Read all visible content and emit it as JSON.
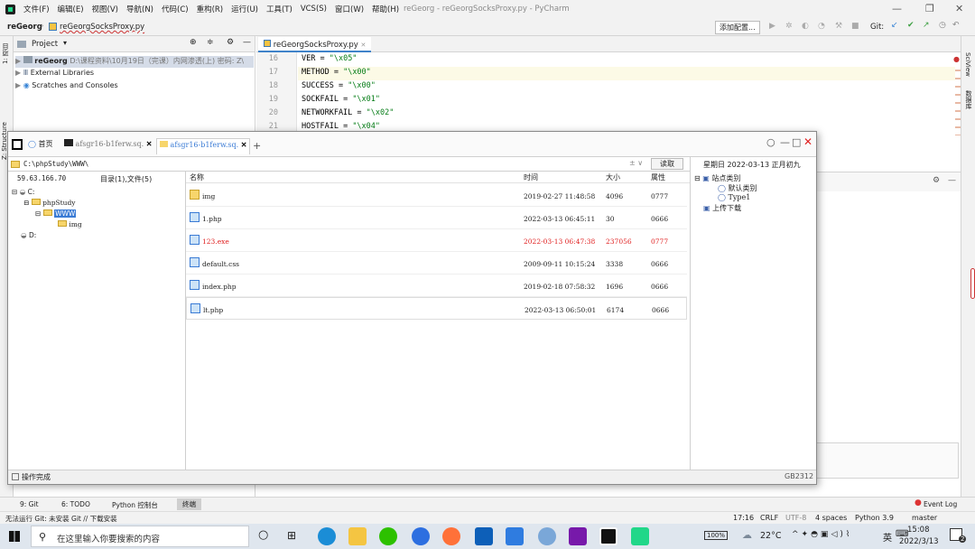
{
  "ide": {
    "menu": [
      "文件(F)",
      "编辑(E)",
      "视图(V)",
      "导航(N)",
      "代码(C)",
      "重构(R)",
      "运行(U)",
      "工具(T)",
      "VCS(S)",
      "窗口(W)",
      "帮助(H)"
    ],
    "window_title": "reGeorg - reGeorgSocksProxy.py - PyCharm",
    "breadcrumb": {
      "project": "reGeorg",
      "file": "reGeorgSocksProxy.py"
    },
    "add_config": "添加配置...",
    "git_label": "Git:",
    "project_panel": {
      "title": "Project",
      "items": [
        {
          "name": "reGeorg",
          "path": "D:\\课程资料\\10月19日（完课）内网渗透(上) 密码: Z\\"
        },
        {
          "name": "External Libraries"
        },
        {
          "name": "Scratches and Consoles"
        }
      ]
    },
    "side_labels": {
      "project": "1: 项目",
      "structure": "Z: Structure",
      "sciview": "SciView",
      "db": "数据库"
    },
    "editor": {
      "tab": "reGeorgSocksProxy.py",
      "lines": [
        {
          "no": "16",
          "name": "VER",
          "val": "\"\\x05\""
        },
        {
          "no": "17",
          "name": "METHOD",
          "val": "\"\\x00\""
        },
        {
          "no": "18",
          "name": "SUCCESS",
          "val": "\"\\x00\""
        },
        {
          "no": "19",
          "name": "SOCKFAIL",
          "val": "\"\\x01\""
        },
        {
          "no": "20",
          "name": "NETWORKFAIL",
          "val": "\"\\x02\""
        },
        {
          "no": "21",
          "name": "HOSTFAIL",
          "val": "\"\\x04\""
        }
      ]
    },
    "bottom_tabs": [
      "9: Git",
      "6: TODO",
      "Python 控制台",
      "终端"
    ],
    "event_log": "Event Log",
    "status_msg": "无法运行 Git: 未安装 Git // 下载安装",
    "status_right": [
      "17:16",
      "CRLF",
      "UTF-8",
      "4 spaces",
      "Python 3.9",
      "master"
    ]
  },
  "chopper": {
    "tabs": [
      "首页",
      "afsgr16-b1ferw.sq.",
      "afsgr16-b1ferw.sq."
    ],
    "address": "C:\\phpStudy\\WWW\\",
    "read_btn": "读取",
    "ip": "59.63.166.70",
    "dir_count": "目录(1),文件(5)",
    "tree": [
      {
        "label": "C:"
      },
      {
        "label": "phpStudy"
      },
      {
        "label": "WWW"
      },
      {
        "label": "img"
      },
      {
        "label": "D:"
      }
    ],
    "columns": [
      "名称",
      "时间",
      "大小",
      "属性"
    ],
    "files": [
      {
        "name": "img",
        "time": "2019-02-27 11:48:58",
        "size": "4096",
        "attr": "0777",
        "folder": true,
        "red": false
      },
      {
        "name": "1.php",
        "time": "2022-03-13 06:45:11",
        "size": "30",
        "attr": "0666",
        "folder": false,
        "red": false
      },
      {
        "name": "123.exe",
        "time": "2022-03-13 06:47:38",
        "size": "237056",
        "attr": "0777",
        "folder": false,
        "red": true
      },
      {
        "name": "default.css",
        "time": "2009-09-11 10:15:24",
        "size": "3338",
        "attr": "0666",
        "folder": false,
        "red": false
      },
      {
        "name": "index.php",
        "time": "2019-02-18 07:58:32",
        "size": "1696",
        "attr": "0666",
        "folder": false,
        "red": false
      },
      {
        "name": "lt.php",
        "time": "2022-03-13 06:50:01",
        "size": "6174",
        "attr": "0666",
        "folder": false,
        "red": false
      }
    ],
    "date_header": "星期日 2022-03-13 正月初九",
    "right_tree": [
      "站点类别",
      "默认类别",
      "Type1",
      "上传下载"
    ],
    "status": "操作完成",
    "encoding": "GB2312"
  },
  "taskbar": {
    "search": "在这里输入你要搜索的内容",
    "battery": "100%",
    "temp": "22°C",
    "ime": "英",
    "time": "15:08",
    "date": "2022/3/13",
    "notify": "2"
  }
}
